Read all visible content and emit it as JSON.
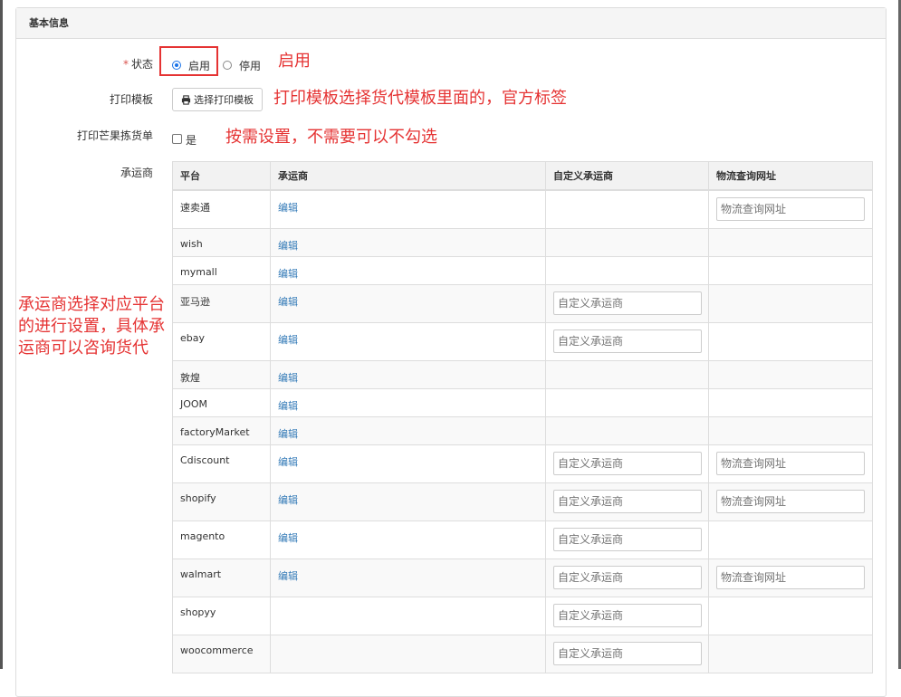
{
  "panel": {
    "title": "基本信息"
  },
  "form": {
    "status": {
      "required_mark": "*",
      "label": "状态",
      "option_on": "启用",
      "option_off": "停用"
    },
    "print_template": {
      "label": "打印模板",
      "button_label": "选择打印模板"
    },
    "pick_list": {
      "label": "打印芒果拣货单",
      "checkbox_label": "是"
    },
    "carrier": {
      "label": "承运商"
    }
  },
  "annotations": {
    "status": "启用",
    "print_template": "打印模板选择货代模板里面的，官方标签",
    "pick_list": "按需设置，不需要可以不勾选",
    "carrier_lines": [
      "承运商选择对应平台",
      "的进行设置，具体承",
      "运商可以咨询货代"
    ]
  },
  "table": {
    "headers": {
      "platform": "平台",
      "carrier": "承运商",
      "custom": "自定义承运商",
      "tracking": "物流查询网址"
    },
    "edit_label": "编辑",
    "custom_placeholder": "自定义承运商",
    "tracking_placeholder": "物流查询网址",
    "rows": [
      {
        "name": "速卖通",
        "edit": true,
        "custom": false,
        "tracking": true,
        "tall": true
      },
      {
        "name": "wish",
        "edit": true,
        "custom": false,
        "tracking": false,
        "tall": false
      },
      {
        "name": "mymall",
        "edit": true,
        "custom": false,
        "tracking": false,
        "tall": false
      },
      {
        "name": "亚马逊",
        "edit": true,
        "custom": true,
        "tracking": false,
        "tall": true
      },
      {
        "name": "ebay",
        "edit": true,
        "custom": true,
        "tracking": false,
        "tall": true
      },
      {
        "name": "敦煌",
        "edit": true,
        "custom": false,
        "tracking": false,
        "tall": false
      },
      {
        "name": "JOOM",
        "edit": true,
        "custom": false,
        "tracking": false,
        "tall": false
      },
      {
        "name": "factoryMarket",
        "edit": true,
        "custom": false,
        "tracking": false,
        "tall": false
      },
      {
        "name": "Cdiscount",
        "edit": true,
        "custom": true,
        "tracking": true,
        "tall": true
      },
      {
        "name": "shopify",
        "edit": true,
        "custom": true,
        "tracking": true,
        "tall": true
      },
      {
        "name": "magento",
        "edit": true,
        "custom": true,
        "tracking": false,
        "tall": true
      },
      {
        "name": "walmart",
        "edit": true,
        "custom": true,
        "tracking": true,
        "tall": true
      },
      {
        "name": "shopyy",
        "edit": false,
        "custom": true,
        "tracking": false,
        "tall": true
      },
      {
        "name": "woocommerce",
        "edit": false,
        "custom": true,
        "tracking": false,
        "tall": true
      }
    ]
  }
}
